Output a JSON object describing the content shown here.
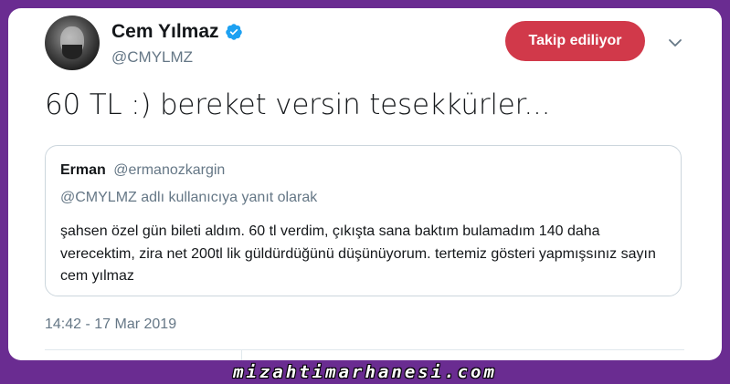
{
  "author": {
    "name": "Cem Yılmaz",
    "handle": "@CMYLMZ",
    "verified": true,
    "avatar_icon": "profile-photo"
  },
  "follow_button": {
    "label": "Takip ediliyor",
    "color": "#d1394a"
  },
  "menu_icon": "chevron-down-icon",
  "tweet": {
    "text": "60 TL :) bereket versin tesekkürler...",
    "timestamp": "14:42 - 17 Mar 2019"
  },
  "quoted_tweet": {
    "name": "Erman",
    "handle": "@ermanozkargin",
    "reply_context": "@CMYLMZ adlı kullanıcıya yanıt olarak",
    "text": "şahsen özel gün bileti aldım. 60 tl verdim, çıkışta sana baktım bulamadım 140 daha verecektim, zira net 200tl lik güldürdüğünü düşünüyorum. tertemiz gösteri yapmışsınız sayın cem yılmaz"
  },
  "watermark": "mizahtimarhanesi.com",
  "colors": {
    "background": "#6a2c91",
    "verified_badge": "#1da1f2",
    "secondary_text": "#657786"
  }
}
